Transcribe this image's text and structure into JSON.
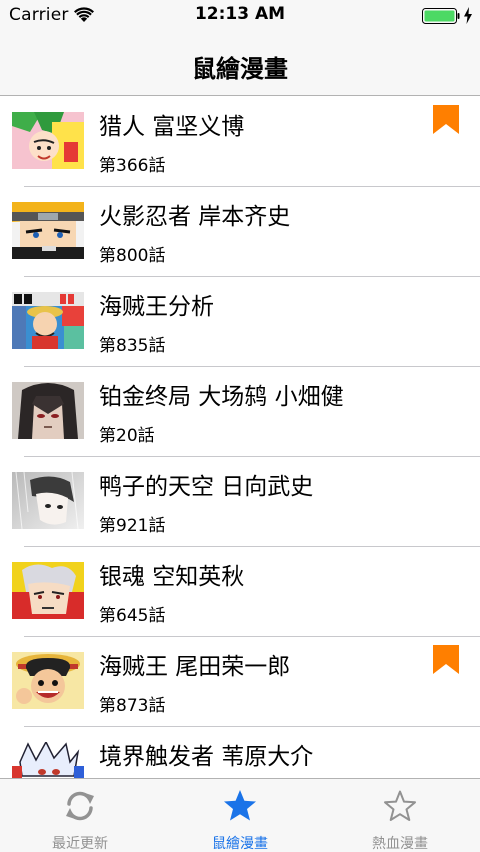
{
  "status_bar": {
    "carrier": "Carrier",
    "time": "12:13 AM",
    "wifi_icon": "wifi-icon",
    "battery_icon": "battery-full-icon",
    "charging_icon": "charging-bolt-icon",
    "battery_color": "#4cd964"
  },
  "nav": {
    "title": "鼠繪漫畫"
  },
  "list": {
    "bookmark_color": "#ff7f00",
    "items": [
      {
        "title": "猎人 富坚义博",
        "chapter": "第366話",
        "bookmarked": true
      },
      {
        "title": "火影忍者 岸本齐史",
        "chapter": "第800話",
        "bookmarked": false
      },
      {
        "title": "海贼王分析",
        "chapter": "第835話",
        "bookmarked": false
      },
      {
        "title": "铂金终局 大场鸫  小畑健",
        "chapter": "第20話",
        "bookmarked": false
      },
      {
        "title": "鸭子的天空 日向武史",
        "chapter": "第921話",
        "bookmarked": false
      },
      {
        "title": "银魂 空知英秋",
        "chapter": "第645話",
        "bookmarked": false
      },
      {
        "title": "海贼王 尾田荣一郎",
        "chapter": "第873話",
        "bookmarked": true
      },
      {
        "title": "境界触发者 苇原大介",
        "chapter": "",
        "bookmarked": false
      }
    ]
  },
  "tab_bar": {
    "active_color": "#1a73e8",
    "inactive_color": "#929292",
    "tabs": [
      {
        "label": "最近更新",
        "icon": "refresh-icon",
        "active": false
      },
      {
        "label": "鼠繪漫畫",
        "icon": "star-filled-icon",
        "active": true
      },
      {
        "label": "熱血漫畫",
        "icon": "star-outline-icon",
        "active": false
      }
    ]
  }
}
